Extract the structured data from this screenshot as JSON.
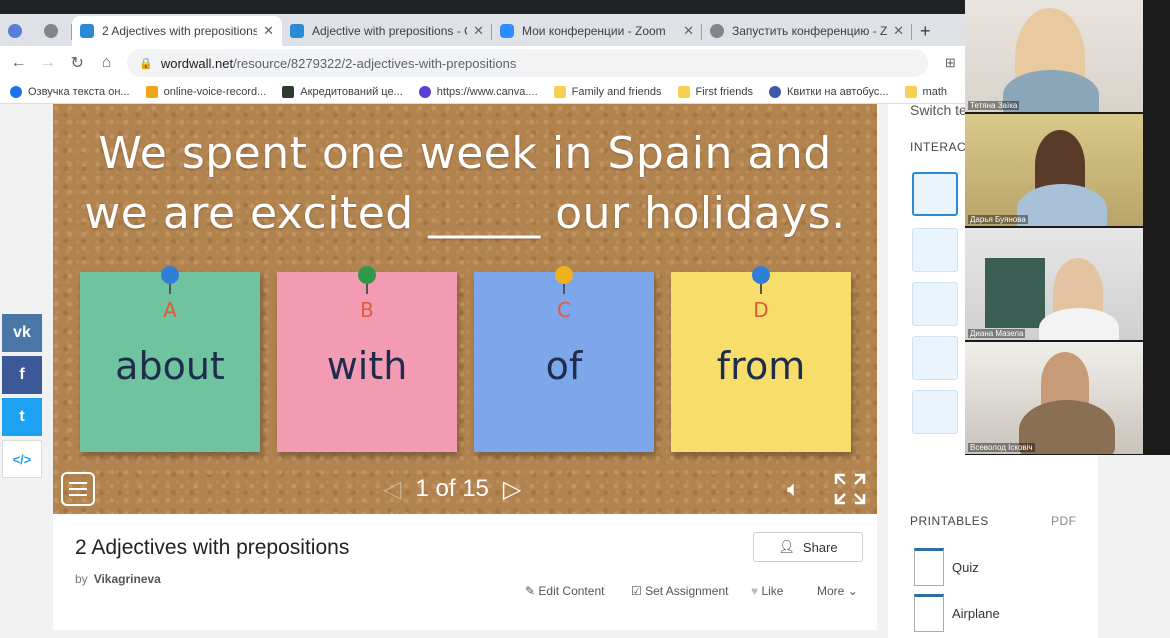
{
  "browser": {
    "tabs": [
      {
        "title": "2 Adjectives with prepositions ",
        "active": true,
        "icon": "wordwall-icon"
      },
      {
        "title": "Adjective with prepositions - O",
        "active": false,
        "icon": "wordwall-icon"
      },
      {
        "title": "Мои конференции - Zoom",
        "active": false,
        "icon": "zoom-icon"
      },
      {
        "title": "Запустить конференцию - Zoo",
        "active": false,
        "icon": "globe-icon"
      }
    ],
    "url_host": "wordwall.net",
    "url_path": "/resource/8279322/2-adjectives-with-prepositions",
    "bookmarks": [
      "Озвучка текста он...",
      "online-voice-record...",
      "Акредитований це...",
      "https://www.canva....",
      "Family and friends",
      "First friends",
      "Квитки на автобус...",
      "math"
    ]
  },
  "activity": {
    "question_line1": "We spent one week in Spain and",
    "question_line2": "we are excited _____ our holidays.",
    "options": [
      {
        "letter": "A",
        "word": "about",
        "color": "#6fc39e",
        "pin": "#2f7fd6"
      },
      {
        "letter": "B",
        "word": "with",
        "color": "#f49bb4",
        "pin": "#2e9a48"
      },
      {
        "letter": "C",
        "word": "of",
        "color": "#7ea6ea",
        "pin": "#f0b21c"
      },
      {
        "letter": "D",
        "word": "from",
        "color": "#f7dd6a",
        "pin": "#2f7fd6"
      }
    ],
    "page_current": "1",
    "page_of": "of",
    "page_total": "15"
  },
  "social": [
    "vk",
    "f",
    "t",
    "</>"
  ],
  "resource": {
    "title": "2 Adjectives with prepositions",
    "by_label": "by",
    "author": "Vikagrineva",
    "share_label": "Share",
    "actions": [
      "Edit Content",
      "Set Assignment",
      "Like",
      "More"
    ]
  },
  "sidebar": {
    "switch_label": "Switch te",
    "interactives_label": "INTERACT",
    "printables_label": "PRINTABLES",
    "pdf_label": "PDF",
    "printables": [
      "Quiz",
      "Airplane"
    ]
  },
  "zoom": {
    "participants": [
      "Тетяна Заїка",
      "Дарья Буянова",
      "Диана Мазела",
      "Всеволод Ісковіч"
    ]
  }
}
